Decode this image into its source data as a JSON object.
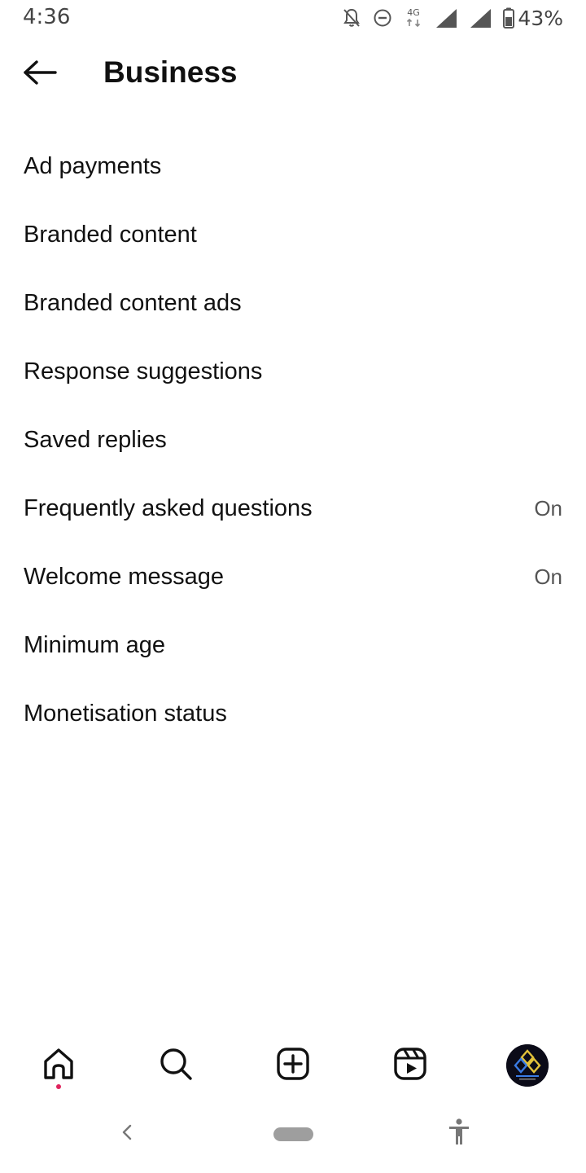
{
  "status_bar": {
    "time": "4:36",
    "network": "4G",
    "battery_percent": "43%",
    "icons": [
      "notifications-off-icon",
      "do-not-disturb-icon",
      "network-4g-icon",
      "signal-icon",
      "signal-icon",
      "battery-icon"
    ]
  },
  "header": {
    "back_icon": "arrow-left-icon",
    "title": "Business"
  },
  "menu": {
    "items": [
      {
        "label": "Ad payments",
        "value": ""
      },
      {
        "label": "Branded content",
        "value": ""
      },
      {
        "label": "Branded content ads",
        "value": ""
      },
      {
        "label": "Response suggestions",
        "value": ""
      },
      {
        "label": "Saved replies",
        "value": ""
      },
      {
        "label": "Frequently asked questions",
        "value": "On"
      },
      {
        "label": "Welcome message",
        "value": "On"
      },
      {
        "label": "Minimum age",
        "value": ""
      },
      {
        "label": "Monetisation status",
        "value": ""
      }
    ]
  },
  "bottom_nav": {
    "items": [
      "home-icon",
      "search-icon",
      "create-post-icon",
      "reels-icon",
      "profile-avatar"
    ],
    "active": "home-icon",
    "notification_dot_color": "#e0245e"
  },
  "system_nav": {
    "items": [
      "back-icon",
      "home-pill",
      "accessibility-icon"
    ]
  },
  "colors": {
    "background": "#ffffff",
    "text": "#111111",
    "secondary_text": "#555555"
  }
}
